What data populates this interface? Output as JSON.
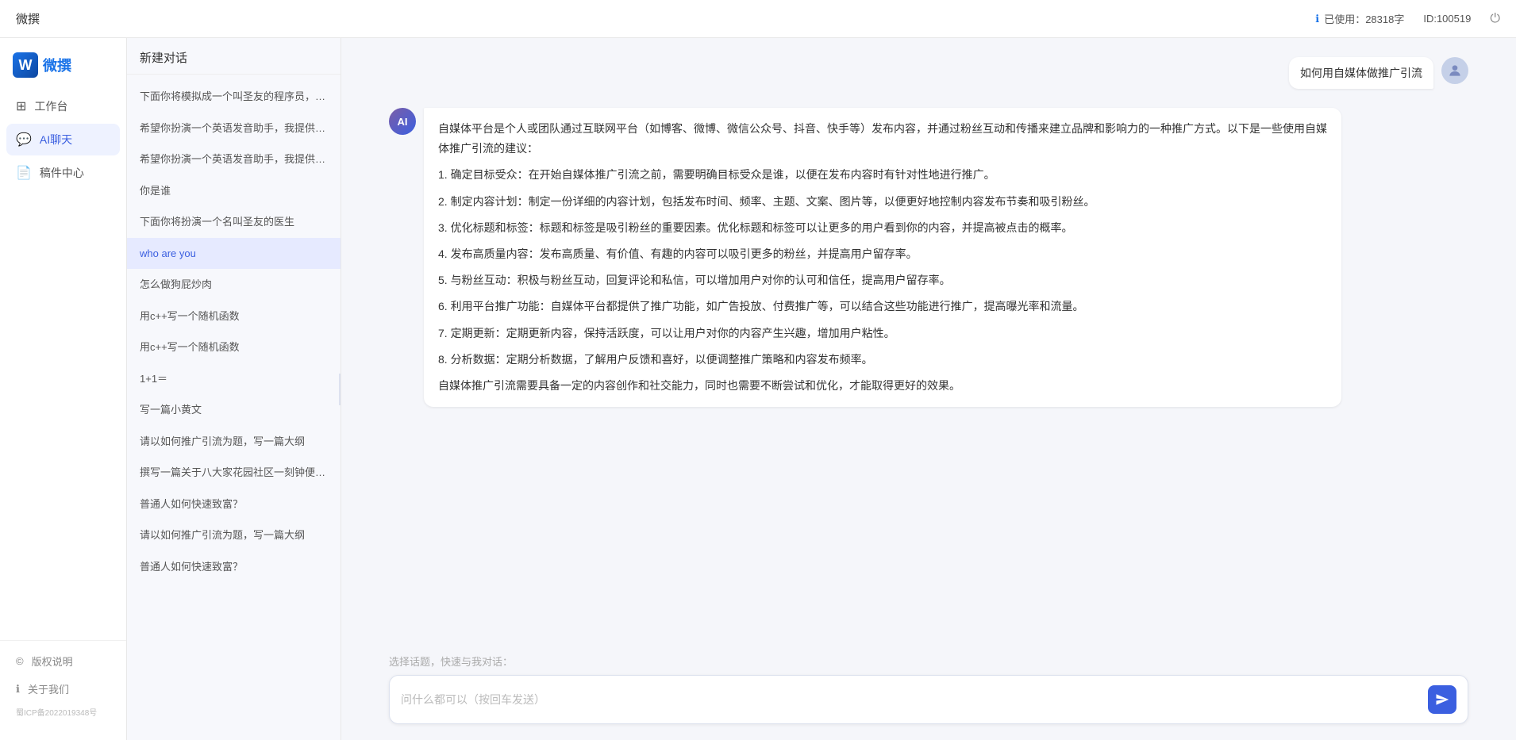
{
  "topbar": {
    "title": "微撰",
    "usage_label": "已使用：28318字",
    "id_label": "ID:100519",
    "info_icon": "ℹ",
    "power_icon": "⏻"
  },
  "sidebar": {
    "logo_text": "微撰",
    "nav_items": [
      {
        "id": "workspace",
        "label": "工作台",
        "icon": "⊞"
      },
      {
        "id": "ai-chat",
        "label": "AI聊天",
        "icon": "💬",
        "active": true
      },
      {
        "id": "drafts",
        "label": "稿件中心",
        "icon": "📄"
      }
    ],
    "bottom_items": [
      {
        "id": "copyright",
        "label": "版权说明",
        "icon": "©"
      },
      {
        "id": "about",
        "label": "关于我们",
        "icon": "ℹ"
      }
    ],
    "icp": "蜀ICP备2022019348号"
  },
  "chat_list": {
    "header": "新建对话",
    "items": [
      {
        "id": 1,
        "text": "下面你将模拟成一个叫圣友的程序员，我说...",
        "active": false
      },
      {
        "id": 2,
        "text": "希望你扮演一个英语发音助手，我提供给你...",
        "active": false
      },
      {
        "id": 3,
        "text": "希望你扮演一个英语发音助手，我提供给你...",
        "active": false
      },
      {
        "id": 4,
        "text": "你是谁",
        "active": false
      },
      {
        "id": 5,
        "text": "下面你将扮演一个名叫圣友的医生",
        "active": false
      },
      {
        "id": 6,
        "text": "who are you",
        "active": true
      },
      {
        "id": 7,
        "text": "怎么做狗屁炒肉",
        "active": false
      },
      {
        "id": 8,
        "text": "用c++写一个随机函数",
        "active": false
      },
      {
        "id": 9,
        "text": "用c++写一个随机函数",
        "active": false
      },
      {
        "id": 10,
        "text": "1+1＝",
        "active": false
      },
      {
        "id": 11,
        "text": "写一篇小黄文",
        "active": false
      },
      {
        "id": 12,
        "text": "请以如何推广引流为题，写一篇大纲",
        "active": false
      },
      {
        "id": 13,
        "text": "撰写一篇关于八大家花园社区一刻钟便民生...",
        "active": false
      },
      {
        "id": 14,
        "text": "普通人如何快速致富？",
        "active": false
      },
      {
        "id": 15,
        "text": "请以如何推广引流为题，写一篇大纲",
        "active": false
      },
      {
        "id": 16,
        "text": "普通人如何快速致富？",
        "active": false
      }
    ]
  },
  "chat": {
    "user_question": "如何用自媒体做推广引流",
    "user_avatar_emoji": "👤",
    "ai_avatar_text": "AI",
    "ai_response_paragraphs": [
      "自媒体平台是个人或团队通过互联网平台（如博客、微博、微信公众号、抖音、快手等）发布内容，并通过粉丝互动和传播来建立品牌和影响力的一种推广方式。以下是一些使用自媒体推广引流的建议：",
      "1. 确定目标受众：在开始自媒体推广引流之前，需要明确目标受众是谁，以便在发布内容时有针对性地进行推广。",
      "2. 制定内容计划：制定一份详细的内容计划，包括发布时间、频率、主题、文案、图片等，以便更好地控制内容发布节奏和吸引粉丝。",
      "3. 优化标题和标签：标题和标签是吸引粉丝的重要因素。优化标题和标签可以让更多的用户看到你的内容，并提高被点击的概率。",
      "4. 发布高质量内容：发布高质量、有价值、有趣的内容可以吸引更多的粉丝，并提高用户留存率。",
      "5. 与粉丝互动：积极与粉丝互动，回复评论和私信，可以增加用户对你的认可和信任，提高用户留存率。",
      "6. 利用平台推广功能：自媒体平台都提供了推广功能，如广告投放、付费推广等，可以结合这些功能进行推广，提高曝光率和流量。",
      "7. 定期更新：定期更新内容，保持活跃度，可以让用户对你的内容产生兴趣，增加用户粘性。",
      "8. 分析数据：定期分析数据，了解用户反馈和喜好，以便调整推广策略和内容发布频率。",
      "自媒体推广引流需要具备一定的内容创作和社交能力，同时也需要不断尝试和优化，才能取得更好的效果。"
    ],
    "input_placeholder": "问什么都可以（按回车发送）",
    "topics_label": "选择话题，快速与我对话："
  }
}
